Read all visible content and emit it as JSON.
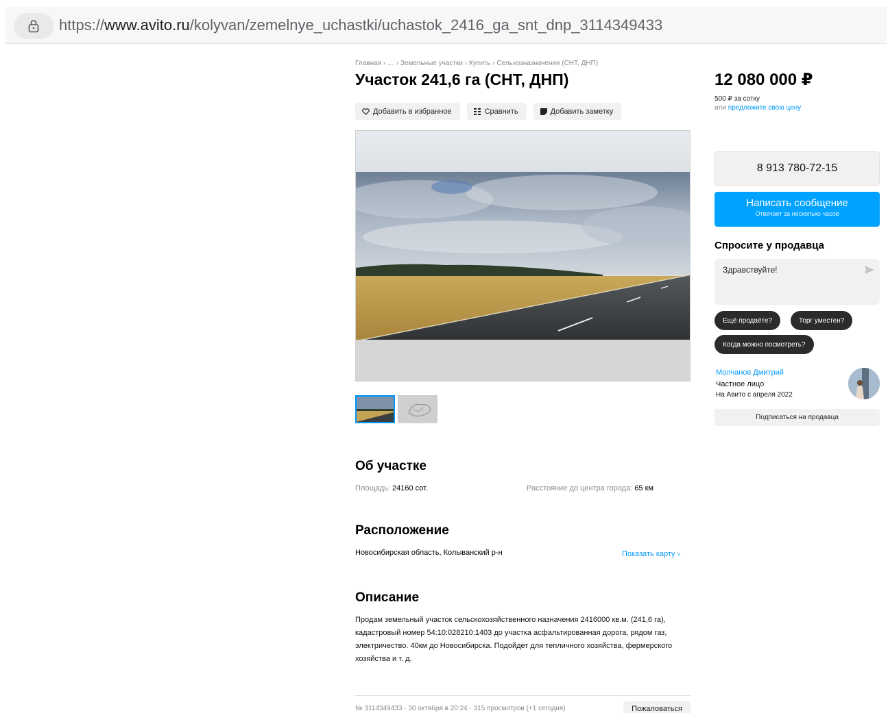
{
  "browser": {
    "url_prefix": "https://",
    "url_host": "www.avito.ru",
    "url_path": "/kolyvan/zemelnye_uchastki/uchastok_2416_ga_snt_dnp_3114349433"
  },
  "breadcrumb": "Главная › … › Земельные участки › Купить › Сельхозназначения (СНТ, ДНП)",
  "title": "Участок 241,6 га (СНТ, ДНП)",
  "actions": {
    "favorite": "Добавить в избранное",
    "compare": "Сравнить",
    "note": "Добавить заметку"
  },
  "about": {
    "heading": "Об участке",
    "area_label": "Площадь:",
    "area_value": "24160 сот.",
    "distance_label": "Расстояние до центра города:",
    "distance_value": "65 км"
  },
  "location": {
    "heading": "Расположение",
    "address": "Новосибирская область, Колыванский р-н",
    "show_map": "Показать карту"
  },
  "description": {
    "heading": "Описание",
    "text": "Продам земельный участок сельскохозяйственного назначения 2416000 кв.м. (241,6 га), кадастровый номер 54:10:028210:1403 до участка асфальтированная дорога, рядом газ, электричество. 40км до Новосибирска. Подойдет для тепличного хозяйства, фермерского хозяйства и т. д."
  },
  "footer": {
    "meta": "№ 3114349433 · 30 октября в 20:24 · 315 просмотров (+1 сегодня)",
    "report": "Пожаловаться"
  },
  "price": {
    "value": "12 080 000 ₽",
    "per_unit": "500 ₽ за сотку",
    "offer_prefix": "или ",
    "offer_link": "предложите свою цену"
  },
  "contact": {
    "phone": "8 913 780-72-15",
    "message_button": "Написать сообщение",
    "message_sub": "Отвечает за несколько часов"
  },
  "ask": {
    "heading": "Спросите у продавца",
    "input_value": "Здравствуйте!",
    "chips": [
      "Ещё продаёте?",
      "Торг уместен?",
      "Когда можно посмотреть?"
    ]
  },
  "seller": {
    "name": "Молчанов Дмитрий",
    "type": "Частное лицо",
    "since": "На Авито с апреля 2022",
    "subscribe": "Подписаться на продавца"
  },
  "colors": {
    "accent": "#00a2ff",
    "link": "#0099f7",
    "chip_bg": "#2b2b2b",
    "button_bg": "#f2f1f0"
  }
}
